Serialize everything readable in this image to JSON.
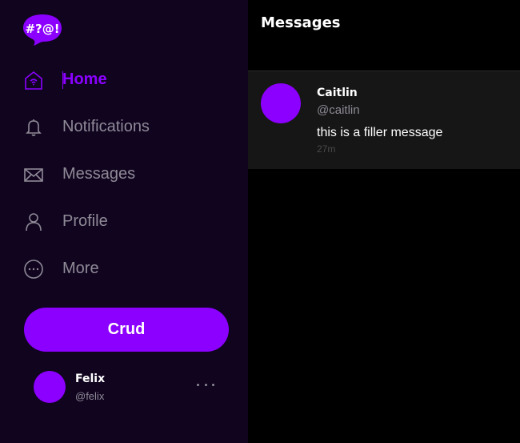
{
  "logo": {
    "text": "#?@!",
    "icon": "speech-bubble-logo"
  },
  "nav": [
    {
      "label": "Home",
      "icon": "home-icon",
      "active": true
    },
    {
      "label": "Notifications",
      "icon": "bell-icon"
    },
    {
      "label": "Messages",
      "icon": "envelope-icon"
    },
    {
      "label": "Profile",
      "icon": "user-icon"
    },
    {
      "label": "More",
      "icon": "more-circle-icon"
    }
  ],
  "compose": {
    "label": "Crud"
  },
  "account": {
    "name": "Felix",
    "handle": "@felix"
  },
  "main": {
    "title": "Messages",
    "messages": [
      {
        "name": "Caitlin",
        "handle": "@caitlin",
        "text": "this is a filler message",
        "time": "27m"
      }
    ]
  },
  "colors": {
    "accent": "#8b00ff",
    "sidebar_bg": "#10041f",
    "muted": "#8f8a96"
  }
}
